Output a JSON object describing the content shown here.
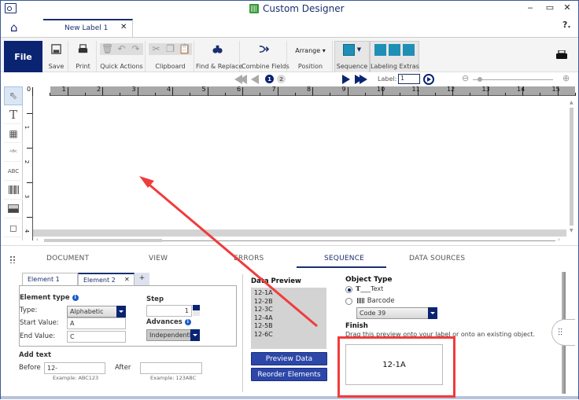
{
  "window": {
    "title": "Custom Designer",
    "controls": {
      "minimize": "‒",
      "maximize": "▭",
      "close": "✕"
    },
    "help": "?."
  },
  "doc_tab": {
    "label": "New Label 1",
    "close": "✕"
  },
  "ribbon": {
    "file_label": "File",
    "groups": {
      "save": "Save",
      "print": "Print",
      "quick_actions": "Quick Actions",
      "clipboard": "Clipboard",
      "find_replace": "Find & Replace",
      "combine_fields": "Combine Fields",
      "arrange": "Arrange ▾",
      "position": "Position",
      "sequence": "Sequence",
      "labeling_extras": "Labeling Extras"
    }
  },
  "nav": {
    "pages": [
      "1",
      "2"
    ],
    "current_page": "1",
    "label_caption": "Label:",
    "label_value": "1"
  },
  "ruler": {
    "h_ticks": [
      "0",
      "1",
      "2",
      "3",
      "4",
      "5",
      "6",
      "7",
      "8",
      "9",
      "10",
      "11",
      "12",
      "13",
      "14",
      "15"
    ],
    "v_ticks": [
      "1",
      "2",
      "3",
      "4"
    ]
  },
  "left_tools": [
    "select-tool",
    "text-tool",
    "datetime-tool",
    "curved-text-tool",
    "sequence-text-tool",
    "barcode-tool",
    "image-tool",
    "shapes-tool"
  ],
  "panel": {
    "tabs": [
      "DOCUMENT",
      "VIEW",
      "ERRORS",
      "SEQUENCE",
      "DATA SOURCES"
    ],
    "active_tab": "SEQUENCE",
    "element_tabs": [
      "Element 1",
      "Element 2"
    ],
    "active_element_tab": "Element 2",
    "element_tab_close": "✕",
    "add_element": "+",
    "element_type": {
      "heading": "Element type",
      "type_label": "Type:",
      "type_value": "Alphabetic",
      "start_label": "Start Value:",
      "start_value": "A",
      "end_label": "End Value:",
      "end_value": "C"
    },
    "step": {
      "heading": "Step",
      "value": "1"
    },
    "advances": {
      "heading": "Advances",
      "value": "Independently"
    },
    "add_text": {
      "heading": "Add text",
      "before_label": "Before",
      "before_value": "12-",
      "before_example": "Example: ABC123",
      "after_label": "After",
      "after_value": "",
      "after_example": "Example: 123ABC"
    },
    "data_preview": {
      "heading": "Data Preview",
      "rows": [
        "12-1A",
        "12-2B",
        "12-3C",
        "12-4A",
        "12-5B",
        "12-6C"
      ],
      "preview_button": "Preview Data",
      "reorder_button": "Reorder Elements"
    },
    "object_type": {
      "heading": "Object Type",
      "options": [
        "Text",
        "Barcode"
      ],
      "selected": "Text",
      "barcode_type": "Code 39"
    },
    "finish": {
      "heading": "Finish",
      "description": "Drag this preview onto your label or onto an existing object.",
      "preview_value": "12-1A"
    }
  },
  "annotation": {
    "color": "#f03c3c"
  }
}
